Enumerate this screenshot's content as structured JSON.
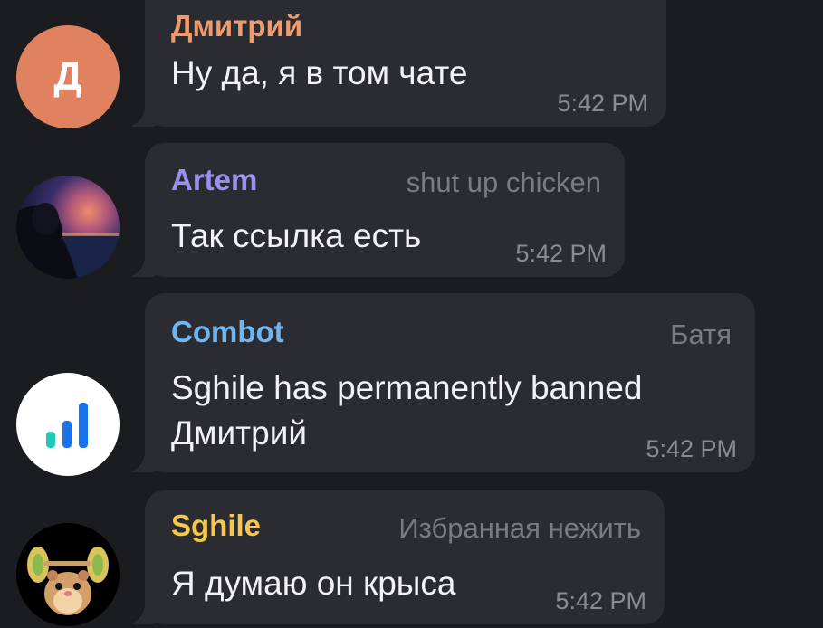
{
  "messages": [
    {
      "sender": "Дмитрий",
      "sender_color": "#f09a6e",
      "title": "",
      "lines": [
        "Ну да, я в том чате"
      ],
      "time": "5:42 PM",
      "avatar": {
        "type": "letter",
        "letter": "Д",
        "color": "#e0825f"
      }
    },
    {
      "sender": "Artem",
      "sender_color": "#9c8ff0",
      "title": "shut up chicken",
      "lines": [
        "Так ссылка есть"
      ],
      "time": "5:42 PM",
      "avatar": {
        "type": "photo"
      }
    },
    {
      "sender": "Combot",
      "sender_color": "#6fb5f0",
      "title": "Батя",
      "lines": [
        "Sghile has permanently banned",
        "Дмитрий"
      ],
      "time": "5:42 PM",
      "avatar": {
        "type": "logo",
        "icon": "bar-chart-logo-icon",
        "color": "#1a73e8",
        "accent": "#21c9b8"
      }
    },
    {
      "sender": "Sghile",
      "sender_color": "#f5c84a",
      "title": "Избранная нежить",
      "lines": [
        "Я думаю он крыса"
      ],
      "time": "5:42 PM",
      "avatar": {
        "type": "sticker",
        "icon": "hamster-icon"
      }
    }
  ]
}
